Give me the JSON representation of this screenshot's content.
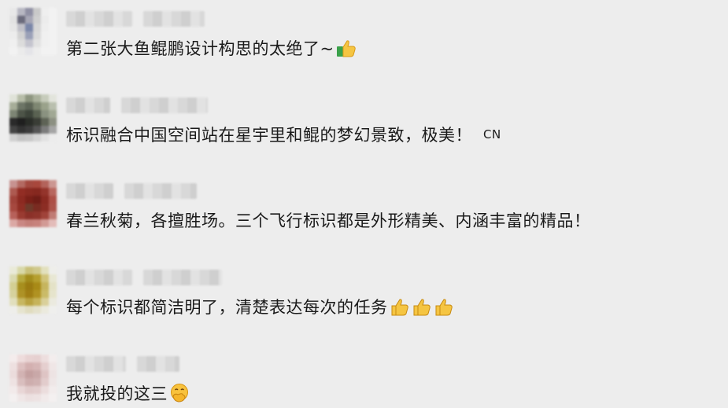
{
  "comments": [
    {
      "text": "第二张大鱼鲲鹏设计构思的太绝了~",
      "emojis": [
        "thumbs-up-green-sleeve"
      ]
    },
    {
      "text": "标识融合中国空间站在星宇里和鲲的梦幻景致，极美！",
      "tag": "CN"
    },
    {
      "text": "春兰秋菊，各擅胜场。三个飞行标识都是外形精美、内涵丰富的精品！"
    },
    {
      "text": "每个标识都简洁明了，清楚表达每次的任务",
      "emojis": [
        "thumbs-up-icon",
        "thumbs-up-icon",
        "thumbs-up-icon"
      ]
    },
    {
      "text": "我就投的这三",
      "emojis": [
        "hand-over-mouth-icon"
      ]
    }
  ]
}
